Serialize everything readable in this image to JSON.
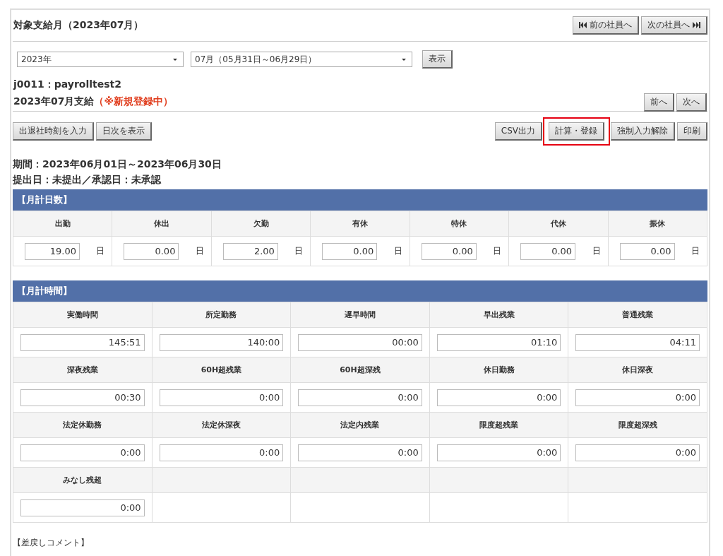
{
  "header": {
    "title": "対象支給月（2023年07月）",
    "nav_buttons": [
      {
        "label": "前の社員へ",
        "kind": "prev"
      },
      {
        "label": "次の社員へ",
        "kind": "next"
      }
    ]
  },
  "filters": {
    "year": "2023年",
    "month": "07月（05月31日～06月29日）",
    "button": "表示"
  },
  "employee": "j0011：payrolltest2",
  "payment": {
    "title": "2023年07月支給",
    "status": "（※新規登録中）"
  },
  "page_buttons": [
    "前へ",
    "次へ"
  ],
  "toolbar_left": [
    {
      "label": "出退社時刻を入力",
      "highlighted": false
    },
    {
      "label": "日次を表示",
      "highlighted": false
    }
  ],
  "toolbar_right": [
    {
      "label": "CSV出力",
      "highlighted": false
    },
    {
      "label": "計算・登録",
      "highlighted": true
    },
    {
      "label": "強制入力解除",
      "highlighted": false
    },
    {
      "label": "印刷",
      "highlighted": false
    }
  ],
  "period": "期間：2023年06月01日～2023年06月30日",
  "submission": "提出日：未提出／承認日：未承認",
  "days": {
    "title": "【月計日数】",
    "items": [
      {
        "label": "出勤",
        "value": "19.00",
        "unit": "日"
      },
      {
        "label": "休出",
        "value": "0.00",
        "unit": "日"
      },
      {
        "label": "欠勤",
        "value": "2.00",
        "unit": "日"
      },
      {
        "label": "有休",
        "value": "0.00",
        "unit": "日"
      },
      {
        "label": "特休",
        "value": "0.00",
        "unit": "日"
      },
      {
        "label": "代休",
        "value": "0.00",
        "unit": "日"
      },
      {
        "label": "振休",
        "value": "0.00",
        "unit": "日"
      }
    ]
  },
  "times": {
    "title": "【月計時間】",
    "items": [
      {
        "label": "実働時間",
        "value": "145:51"
      },
      {
        "label": "所定勤務",
        "value": "140:00"
      },
      {
        "label": "遅早時間",
        "value": "00:00"
      },
      {
        "label": "早出残業",
        "value": "01:10"
      },
      {
        "label": "普通残業",
        "value": "04:11"
      },
      {
        "label": "深夜残業",
        "value": "00:30"
      },
      {
        "label": "60H超残業",
        "value": "0:00"
      },
      {
        "label": "60H超深残",
        "value": "0:00"
      },
      {
        "label": "休日勤務",
        "value": "0:00"
      },
      {
        "label": "休日深夜",
        "value": "0:00"
      },
      {
        "label": "法定休勤務",
        "value": "0:00"
      },
      {
        "label": "法定休深夜",
        "value": "0:00"
      },
      {
        "label": "法定内残業",
        "value": "0:00"
      },
      {
        "label": "限度超残業",
        "value": "0:00"
      },
      {
        "label": "限度超深残",
        "value": "0:00"
      },
      {
        "label": "みなし残超",
        "value": "0:00"
      }
    ]
  },
  "comment_label": "【差戻しコメント】"
}
